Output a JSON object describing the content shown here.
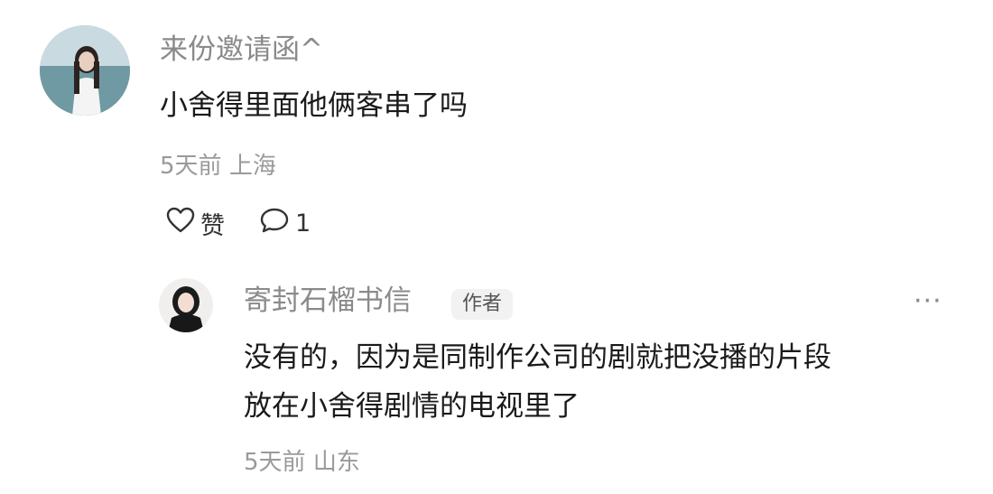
{
  "comment": {
    "username": "来份邀请函^",
    "text": "小舍得里面他俩客串了吗",
    "time": "5天前",
    "location": "上海",
    "like_label": "赞",
    "reply_count": "1"
  },
  "reply": {
    "username": "寄封石榴书信",
    "badge": "作者",
    "text_line1": "没有的，因为是同制作公司的剧就把没播的片段",
    "text_line2": "放在小舍得剧情的电视里了",
    "time": "5天前",
    "location": "山东",
    "more": "···"
  },
  "icons": {
    "like": "heart-outline-icon",
    "reply": "speech-bubble-icon",
    "more": "more-dots-icon"
  }
}
